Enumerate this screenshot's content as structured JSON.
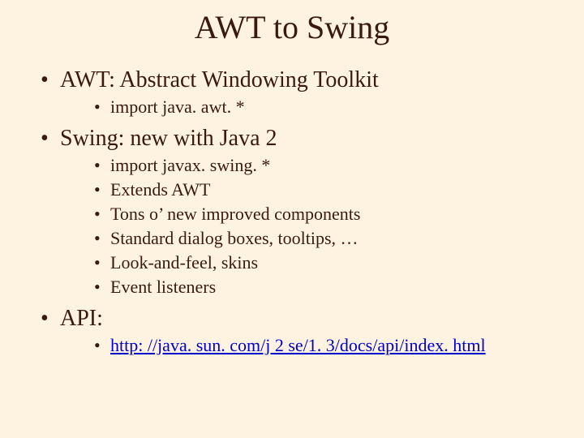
{
  "title": "AWT to Swing",
  "items": {
    "awt": {
      "label": "AWT:  Abstract Windowing Toolkit",
      "sub": [
        "import java. awt. *"
      ]
    },
    "swing": {
      "label": "Swing:  new with Java 2",
      "sub": [
        "import javax. swing. *",
        "Extends AWT",
        "Tons o’ new improved components",
        "Standard dialog boxes, tooltips, …",
        "Look-and-feel, skins",
        "Event listeners"
      ]
    },
    "api": {
      "label": "API:",
      "link": "http: //java. sun. com/j 2 se/1. 3/docs/api/index. html"
    }
  }
}
